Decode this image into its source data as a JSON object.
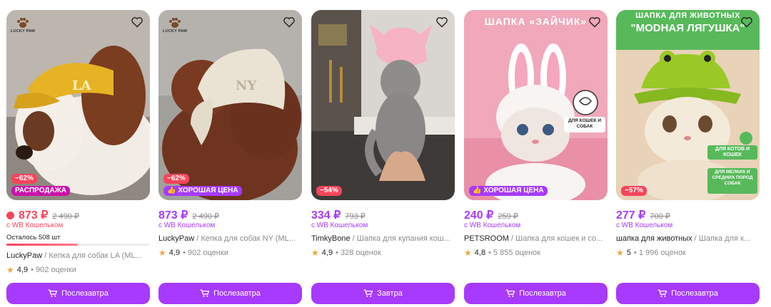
{
  "colors": {
    "accent": "#a73afd",
    "sale": "#f5455b",
    "promo": "#cb11ab",
    "star": "#f0a341"
  },
  "cards": [
    {
      "brand_logo": "LUCKY PAW",
      "discount": "−62%",
      "promo_label": "РАСПРОДАЖА",
      "price": "873 ₽",
      "old_price": "2 490 ₽",
      "wallet": "с WB Кошельком",
      "stock": "Осталось 508 шт",
      "stock_fraction": 0.5,
      "brand": "LuckyPaw",
      "name": "/ Кепка для собак LA (ML...",
      "rating": "4,9",
      "reviews": "902 оценки",
      "button": "Послезавтра",
      "icon": "heart-icon"
    },
    {
      "brand_logo": "LUCKY PAW",
      "discount": "−62%",
      "promo_label": "ХОРОШАЯ ЦЕНА",
      "price": "873 ₽",
      "old_price": "2 490 ₽",
      "wallet": "с WB Кошельком",
      "brand": "LuckyPaw",
      "name": "/ Кепка для собак NY (ML...",
      "rating": "4,9",
      "reviews": "902 оценки",
      "button": "Послезавтра"
    },
    {
      "discount": "−54%",
      "price": "334 ₽",
      "old_price": "793 ₽",
      "wallet": "с WB Кошельком",
      "brand": "TimkyBone",
      "name": "/ Шапка для купания кош...",
      "rating": "4,9",
      "reviews": "328 оценок",
      "button": "Завтра"
    },
    {
      "overlay_title": "ШАПКА «ЗАЙЧИК»",
      "overlay_tag": "ДЛЯ КОШЕК И СОБАК",
      "promo_label": "ХОРОШАЯ ЦЕНА",
      "price": "240 ₽",
      "old_price": "259 ₽",
      "wallet": "с WB Кошельком",
      "brand": "PETSROOM",
      "name": "/ Шапка для кошек и со...",
      "rating": "4,8",
      "reviews": "5 855 оценок",
      "button": "Послезавтра"
    },
    {
      "overlay_line1": "ШАПКА ДЛЯ ЖИВОТНЫХ",
      "overlay_line2": "\"МОDНАЯ ЛЯГУШКА\"",
      "overlay_tag1": "ДЛЯ КОТОВ И КОШЕК",
      "overlay_tag2": "ДЛЯ МЕЛКИХ И СРЕДНИХ ПОРОД СОБАК",
      "discount": "−57%",
      "price": "277 ₽",
      "old_price": "700 ₽",
      "wallet": "с WB Кошельком",
      "brand": "шапка для животных",
      "name": "/ Шапка для к...",
      "rating": "5",
      "reviews": "1 996 оценок",
      "button": "Послезавтра"
    }
  ]
}
